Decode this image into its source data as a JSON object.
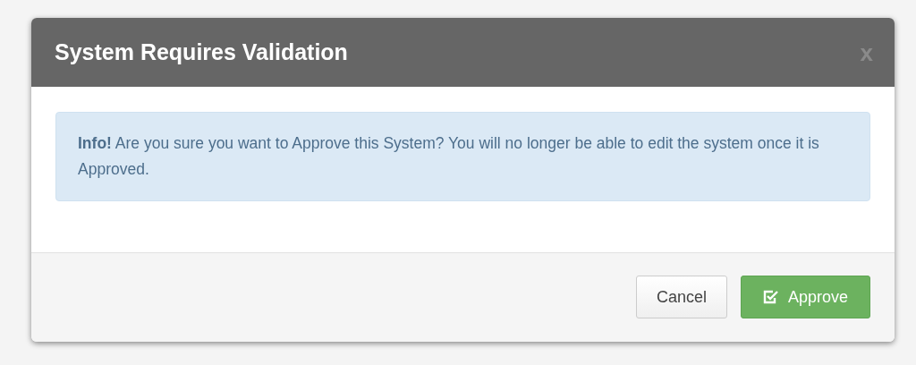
{
  "dialog": {
    "title": "System Requires Validation",
    "close": "x",
    "alert": {
      "text": "**Info!** Are you sure you want to Approve this System? You will no longer be able to edit the system once it is Approved."
    },
    "buttons": [
      {
        "kind": "default",
        "label": "Cancel"
      },
      {
        "kind": "primary",
        "label": "Approve"
      }
    ]
  }
}
